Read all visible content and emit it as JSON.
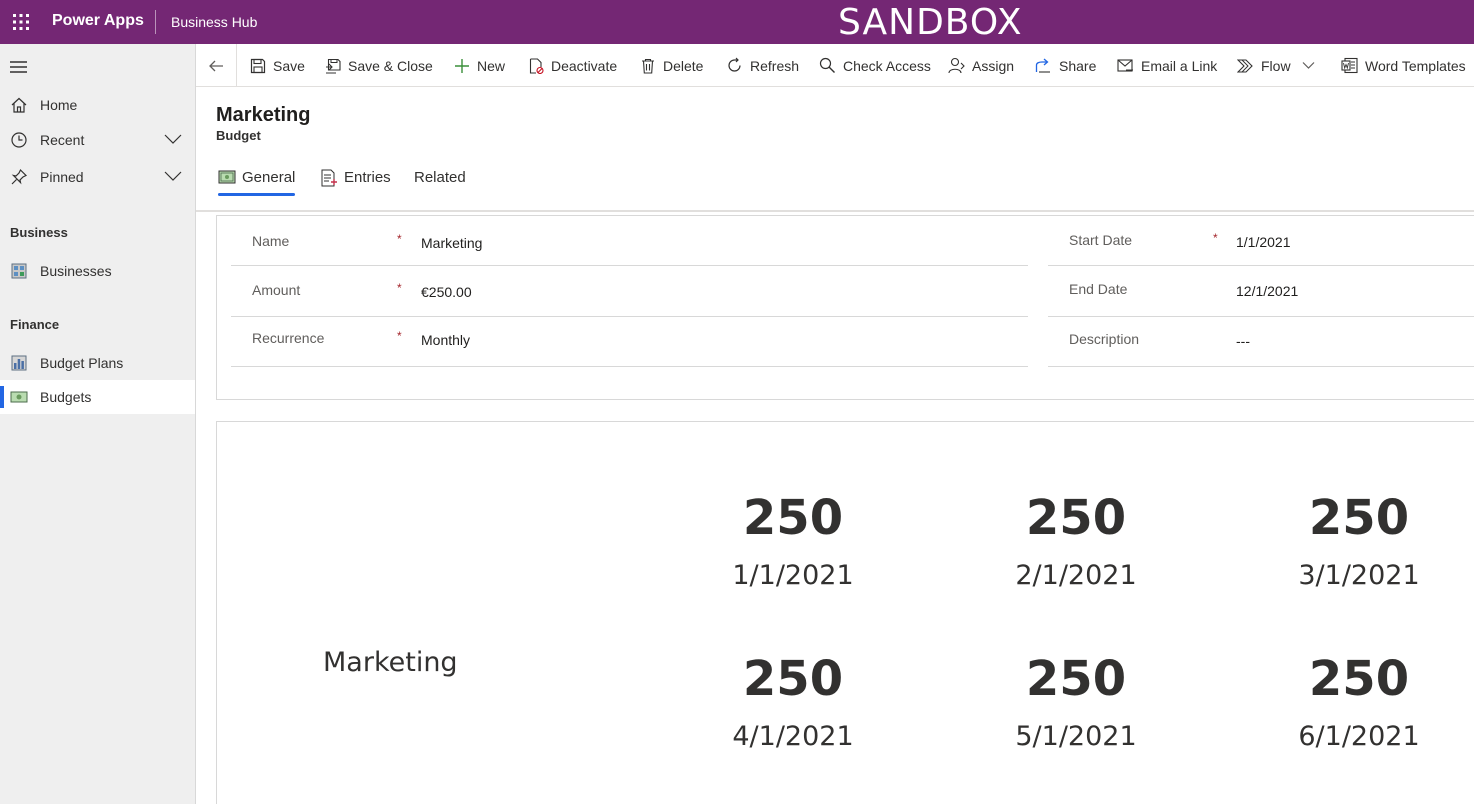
{
  "topbar": {
    "app_name": "Power Apps",
    "env_name": "Business Hub",
    "banner": "SANDBOX",
    "color": "#742774"
  },
  "sidebar": {
    "items": [
      {
        "label": "Home",
        "icon": "home-icon"
      },
      {
        "label": "Recent",
        "icon": "clock-icon"
      },
      {
        "label": "Pinned",
        "icon": "pin-icon"
      }
    ],
    "sections": [
      {
        "title": "Business",
        "items": [
          {
            "label": "Businesses",
            "icon": "table-icon"
          }
        ]
      },
      {
        "title": "Finance",
        "items": [
          {
            "label": "Budget Plans",
            "icon": "chart-icon"
          },
          {
            "label": "Budgets",
            "icon": "money-icon",
            "selected": true
          }
        ]
      }
    ]
  },
  "commandbar": {
    "save": "Save",
    "save_close": "Save & Close",
    "new": "New",
    "deactivate": "Deactivate",
    "delete": "Delete",
    "refresh": "Refresh",
    "check_access": "Check Access",
    "assign": "Assign",
    "share": "Share",
    "email_link": "Email a Link",
    "flow": "Flow",
    "word_templates": "Word Templates"
  },
  "header": {
    "title": "Marketing",
    "subtitle": "Budget",
    "tabs": [
      "General",
      "Entries",
      "Related"
    ]
  },
  "form": {
    "left": [
      {
        "label": "Name",
        "required": "*",
        "value": "Marketing"
      },
      {
        "label": "Amount",
        "required": "*",
        "value": "€250.00"
      },
      {
        "label": "Recurrence",
        "required": "*",
        "value": "Monthly"
      }
    ],
    "right": [
      {
        "label": "Start Date",
        "required": "*",
        "value": "1/1/2021"
      },
      {
        "label": "End Date",
        "required": "",
        "value": "12/1/2021"
      },
      {
        "label": "Description",
        "required": "",
        "value": "---"
      }
    ]
  },
  "entries": {
    "label": "Marketing",
    "items": [
      {
        "amount": "250",
        "date": "1/1/2021"
      },
      {
        "amount": "250",
        "date": "2/1/2021"
      },
      {
        "amount": "250",
        "date": "3/1/2021"
      },
      {
        "amount": "250",
        "date": "4/1/2021"
      },
      {
        "amount": "250",
        "date": "5/1/2021"
      },
      {
        "amount": "250",
        "date": "6/1/2021"
      }
    ]
  },
  "colors": {
    "accent": "#2266e3",
    "required": "#a4262c"
  }
}
